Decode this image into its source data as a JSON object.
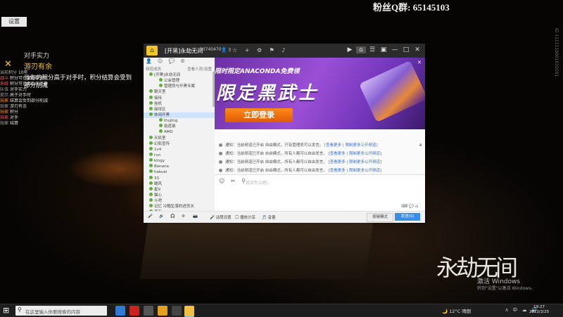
{
  "stream": {
    "fan_group": "粉丝Q群: 65145103",
    "top_tag": "设置",
    "overlay": {
      "title": "对手实力",
      "mode": "游刃有余",
      "desc": "当你的积分高于对手时，积分结算会受到部分削减"
    },
    "chat": [
      {
        "user": "当前积分",
        "text": "10年",
        "cls": "c-grey"
      },
      {
        "user": "战斗",
        "text": "积分可在面板中查看",
        "cls": "c-red"
      },
      {
        "user": "系统",
        "text": "积分可在面板中查看",
        "cls": "c-red"
      },
      {
        "user": "队伍",
        "text": "对手实力",
        "cls": "c-grey"
      },
      {
        "user": "提示",
        "text": "高于对手时",
        "cls": "c-grey"
      },
      {
        "user": "玩家",
        "text": "结算会受到部分削减",
        "cls": "c-ora"
      },
      {
        "user": "玩家",
        "text": "游刃有余",
        "cls": "c-grey"
      },
      {
        "user": "玩家",
        "text": "积分",
        "cls": "c-ora"
      },
      {
        "user": "玩家",
        "text": "对手",
        "cls": "c-red"
      },
      {
        "user": "玩家",
        "text": "结算",
        "cls": "c-grey"
      }
    ],
    "logo": "永劫无间",
    "activate_title": "激活 Windows",
    "activate_sub": "转到\"设置\"以激活 Windows。"
  },
  "window": {
    "channel_name": "[开黑]永劫无间",
    "channel_id": "10740470",
    "member_count": "3",
    "toolbar_icons": "☆ + ⚙ ⚑ ♪",
    "controls": [
      "▶",
      "⌂",
      "☰",
      "▣",
      "—",
      "□",
      "✕"
    ],
    "sidebar": {
      "top_icons": "👤 ☺ 💬 ⚙",
      "header_left": "频道成员",
      "header_right": "查看人员/设置",
      "channels": [
        {
          "label": "[开黑]永劫无间",
          "cls": ""
        },
        {
          "label": "公会管理",
          "cls": "sub"
        },
        {
          "label": "管理员与开黑专属",
          "cls": "sub"
        },
        {
          "label": "聊天室",
          "cls": ""
        },
        {
          "label": "接待",
          "cls": ""
        },
        {
          "label": "挂机",
          "cls": ""
        },
        {
          "label": "接待区",
          "cls": ""
        },
        {
          "label": "休闲开黑",
          "cls": "sel"
        },
        {
          "label": "thuJing",
          "cls": "sub"
        },
        {
          "label": "拾遗录",
          "cls": "sub"
        },
        {
          "label": "AMD",
          "cls": "sub"
        },
        {
          "label": "天机室",
          "cls": ""
        },
        {
          "label": "幻影宣传",
          "cls": ""
        },
        {
          "label": "1v4",
          "cls": ""
        },
        {
          "label": "run",
          "cls": ""
        },
        {
          "label": "kingy",
          "cls": ""
        },
        {
          "label": "Banana",
          "cls": ""
        },
        {
          "label": "hakuei",
          "cls": ""
        },
        {
          "label": "33",
          "cls": ""
        },
        {
          "label": "飓风",
          "cls": ""
        },
        {
          "label": "星9",
          "cls": ""
        },
        {
          "label": "猫心",
          "cls": ""
        },
        {
          "label": "斗吧",
          "cls": ""
        },
        {
          "label": "记忆 冷酷坠落的进贡水",
          "cls": ""
        },
        {
          "label": "百万",
          "cls": ""
        }
      ]
    },
    "banner": {
      "sub": "限时限定ANACONDA免费领",
      "main": "限定黑武士",
      "button": "立即登录"
    },
    "messages": [
      {
        "text": "通知：当前频道已开启 自由模式，只有管理员可以发言。",
        "link": "[查看更多 | 限制更多公开频道]"
      },
      {
        "text": "通知：当前频道已开启 自由模式，所有人都可以自由发言。",
        "link": "[查看更多 | 限制更多公开频道]"
      },
      {
        "text": "通知：当前频道已开启 自由模式，所有人都可以自由发言，",
        "link": "[查看更多 | 限制更多公开频道]"
      },
      {
        "text": "通知：当前频道已开启 自由模式，所有人都可以自由发言，",
        "link": "[查看更多 | 限制更多公开频道]"
      }
    ],
    "input": {
      "icons": "☺ ✂ ⚲",
      "placeholder": "说点什么吧...",
      "right": "⌨ 💬 ⌂"
    },
    "bottom": {
      "items": [
        "🎤",
        "🔊",
        "🎧",
        "⚙",
        "📷",
        "🎤 话筒设置",
        "🖵 播放分享",
        "🎵 音量"
      ],
      "send_mode": "按键模式",
      "send": "发送(S)"
    }
  },
  "taskbar": {
    "start": "⊞",
    "search_icon": "⚲",
    "search_placeholder": "在这里输入你要搜索的内容",
    "weather": "🌙 12°C 晴朗",
    "tray_icons": "ᴧ 中 ☁ 🔊",
    "time": "19:27",
    "date": "2022/2/25"
  }
}
